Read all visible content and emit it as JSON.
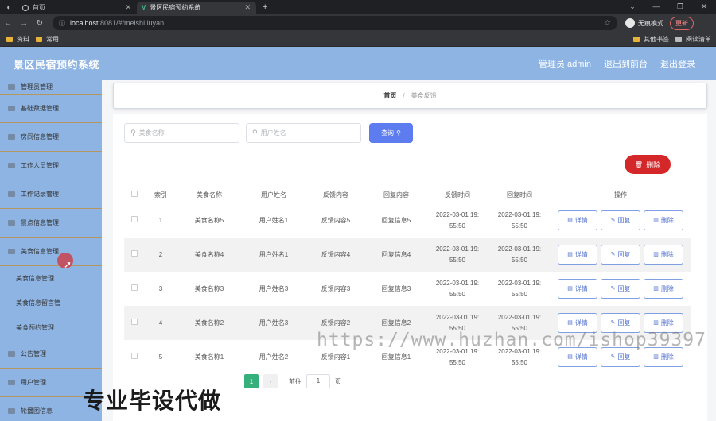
{
  "browser": {
    "tabs": [
      {
        "title": "首页"
      },
      {
        "title": "景区民宿预约系统"
      }
    ],
    "url_host": "localhost",
    "url_path": ":8081/#/meishi.luyan",
    "incognito_label": "无痕模式",
    "update_label": "更新",
    "bookmarks": [
      "资料",
      "常用"
    ],
    "bookmarks_right": [
      "其他书签",
      "阅读清单"
    ]
  },
  "app": {
    "title": "景区民宿预约系统",
    "admin_label": "管理员 admin",
    "back_frontend": "退出到前台",
    "logout": "退出登录"
  },
  "sidebar": {
    "items": [
      {
        "label": "管理员管理",
        "sub": false
      },
      {
        "label": "基础数据管理",
        "sub": false
      },
      {
        "label": "房间信息管理",
        "sub": false
      },
      {
        "label": "工作人员管理",
        "sub": false
      },
      {
        "label": "工作记录管理",
        "sub": false
      },
      {
        "label": "景点信息管理",
        "sub": false
      },
      {
        "label": "美食信息管理",
        "sub": false
      },
      {
        "label": "美食信息管理",
        "sub": true
      },
      {
        "label": "美食信息留言管",
        "sub": true
      },
      {
        "label": "美食预约管理",
        "sub": true
      },
      {
        "label": "公告管理",
        "sub": false
      },
      {
        "label": "用户管理",
        "sub": false
      },
      {
        "label": "轮播图信息",
        "sub": false
      }
    ]
  },
  "breadcrumb": {
    "home": "首页",
    "separator": "/",
    "current": "美食反馈"
  },
  "search": {
    "food_placeholder": "美食名称",
    "user_placeholder": "用户姓名",
    "query_label": "查询"
  },
  "delete_label": "删除",
  "table": {
    "headers": [
      "索引",
      "美食名称",
      "用户姓名",
      "反馈内容",
      "回复内容",
      "反馈时间",
      "回复时间",
      "操作"
    ],
    "rows": [
      {
        "idx": "1",
        "food": "美食名称5",
        "user": "用户姓名1",
        "feedback": "反馈内容5",
        "reply": "回复信息5",
        "ftime1": "2022-03-01 19:",
        "ftime2": "55:50",
        "rtime1": "2022-03-01 19:",
        "rtime2": "55:50"
      },
      {
        "idx": "2",
        "food": "美食名称4",
        "user": "用户姓名1",
        "feedback": "反馈内容4",
        "reply": "回复信息4",
        "ftime1": "2022-03-01 19:",
        "ftime2": "55:50",
        "rtime1": "2022-03-01 19:",
        "rtime2": "55:50"
      },
      {
        "idx": "3",
        "food": "美食名称3",
        "user": "用户姓名3",
        "feedback": "反馈内容3",
        "reply": "回复信息3",
        "ftime1": "2022-03-01 19:",
        "ftime2": "55:50",
        "rtime1": "2022-03-01 19:",
        "rtime2": "55:50"
      },
      {
        "idx": "4",
        "food": "美食名称2",
        "user": "用户姓名3",
        "feedback": "反馈内容2",
        "reply": "回复信息2",
        "ftime1": "2022-03-01 19:",
        "ftime2": "55:50",
        "rtime1": "2022-03-01 19:",
        "rtime2": "55:50"
      },
      {
        "idx": "5",
        "food": "美食名称1",
        "user": "用户姓名2",
        "feedback": "反馈内容1",
        "reply": "回复信息1",
        "ftime1": "2022-03-01 19:",
        "ftime2": "55:50",
        "rtime1": "2022-03-01 19:",
        "rtime2": "55:50"
      }
    ],
    "op_labels": {
      "detail": "详情",
      "reply": "回复",
      "delete": "删除"
    }
  },
  "pager": {
    "current_page": "1",
    "goto_label": "前往",
    "goto_value": "1",
    "page_unit": "页"
  },
  "overlay": {
    "watermark": "https://www.huzhan.com/ishop39397",
    "promo": "专业毕设代做"
  },
  "colors": {
    "header_bg": "#8eb4e3",
    "query_btn": "#5c7cf0",
    "delete_btn": "#d3272a",
    "pager_active": "#35b07a"
  }
}
